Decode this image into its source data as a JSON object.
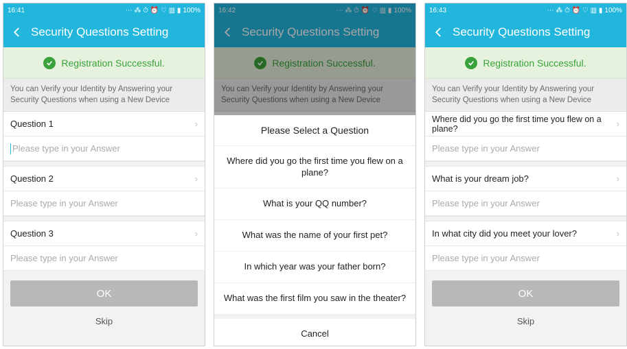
{
  "statusbar": {
    "time1": "16:41",
    "time2": "16:42",
    "time3": "16:43",
    "battery": "100%",
    "icons": "⋯ ⁂ ⏱ ⏰ ♡ ▥ ▮"
  },
  "title": "Security Questions Setting",
  "success": "Registration Successful.",
  "info": "You can Verify your Identity by Answering your Security Questions when using a New Device",
  "q_labels": {
    "q1": "Question 1",
    "q2": "Question 2",
    "q3": "Question 3"
  },
  "answer_placeholder": "Please type in your Answer",
  "ok": "OK",
  "skip": "Skip",
  "sheet": {
    "title": "Please Select a Question",
    "options": [
      "Where did you go the first time you flew on a plane?",
      "What is your QQ number?",
      "What was the name of your first pet?",
      "In which year was your father born?",
      "What was the first film you saw in the theater?"
    ],
    "cancel": "Cancel"
  },
  "selected": {
    "q1": "Where did you go the first time you flew on a plane?",
    "q2": "What is your dream job?",
    "q3": "In what city did you meet your lover?"
  }
}
